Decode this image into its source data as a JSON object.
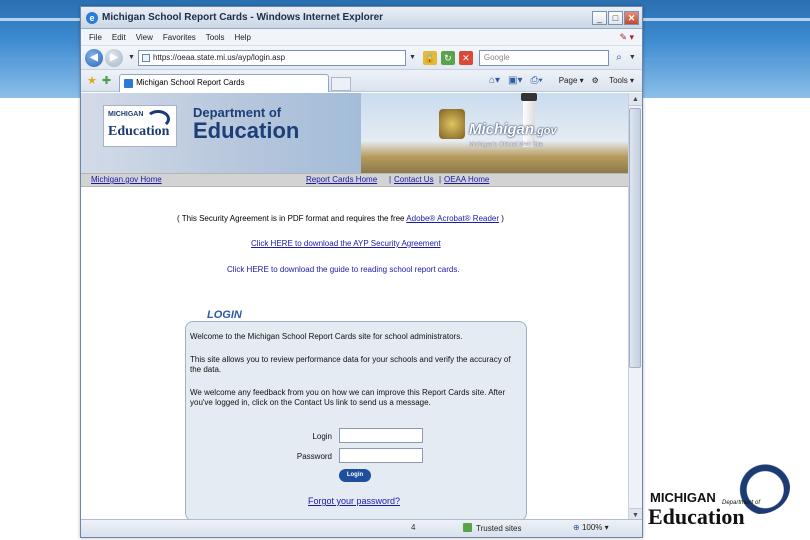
{
  "window": {
    "title": "Michigan School Report Cards - Windows Internet Explorer"
  },
  "menu": [
    "File",
    "Edit",
    "View",
    "Favorites",
    "Tools",
    "Help"
  ],
  "address": {
    "url": "https://oeaa.state.mi.us/ayp/login.asp"
  },
  "search": {
    "placeholder": "Google"
  },
  "tab": {
    "label": "Michigan School Report Cards"
  },
  "commands": {
    "page": "Page",
    "tools": "Tools"
  },
  "banner": {
    "logo_michigan": "MICHIGAN",
    "logo_education": "Education",
    "dept_line1": "Department of",
    "dept_line2": "Education",
    "michigan_gov": "Michigan",
    "gov_suffix": ".gov",
    "tagline": "Michigan's Official Web Site"
  },
  "nav": {
    "home": "Michigan.gov Home",
    "report_cards_home": "Report Cards Home",
    "contact_us": "Contact Us",
    "oeaa_home": "OEAA Home",
    "sep": "|"
  },
  "content": {
    "security_prefix": "( This Security Agreement is in PDF format and requires the free ",
    "acrobat_link": "Adobe® Acrobat® Reader",
    "security_suffix": " )",
    "download_agreement": "Click HERE to download the AYP Security Agreement",
    "download_guide": "Click HERE to download the guide to reading school report cards.",
    "login_title": "LOGIN"
  },
  "login": {
    "welcome": "Welcome to the Michigan School Report Cards site for school administrators.",
    "site_info": "This site allows you to review performance data for your schools and verify the accuracy of the data.",
    "feedback": "We welcome any feedback from you on how we can improve this Report Cards site. After you've logged in, click on the Contact Us link to send us a message.",
    "login_label": "Login",
    "password_label": "Password",
    "button": "Login",
    "forgot": "Forgot your password?"
  },
  "status": {
    "text": "4",
    "zone": "Trusted sites",
    "zoom": "100%"
  },
  "slide_logo": {
    "michigan": "MICHIGAN",
    "department": "Department of",
    "education": "Education"
  }
}
